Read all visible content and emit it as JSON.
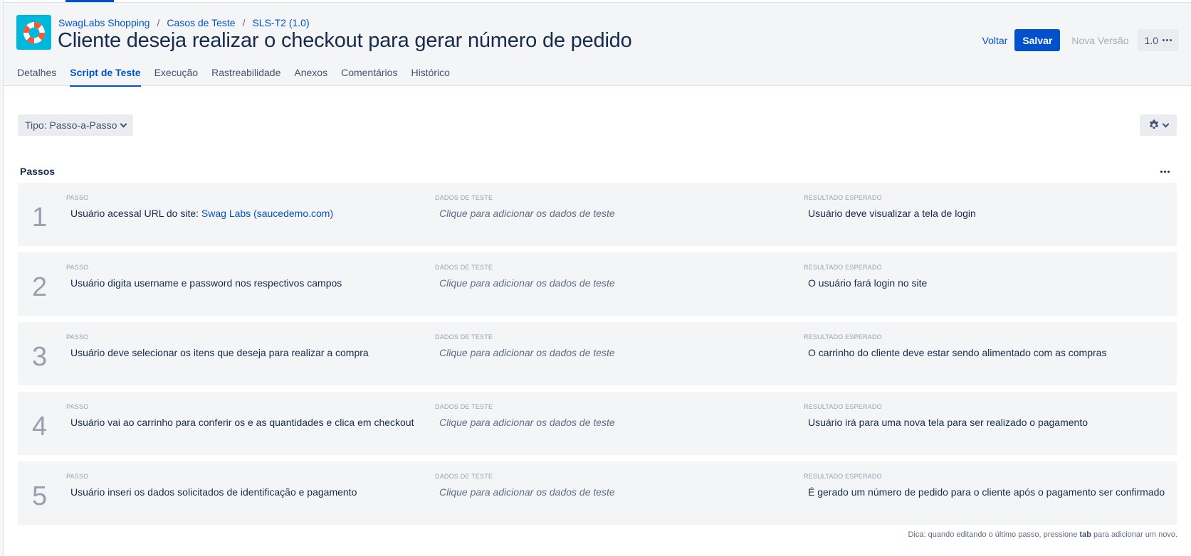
{
  "breadcrumb": {
    "project": "SwagLabs Shopping",
    "section": "Casos de Teste",
    "item": "SLS-T2 (1.0)",
    "separator": "/"
  },
  "page_title": "Cliente deseja realizar o checkout para gerar número de pedido",
  "actions": {
    "back_label": "Voltar",
    "save_label": "Salvar",
    "new_version_label": "Nova Versão",
    "version_label": "1.0"
  },
  "tabs": [
    {
      "label": "Detalhes"
    },
    {
      "label": "Script de Teste"
    },
    {
      "label": "Execução"
    },
    {
      "label": "Rastreabilidade"
    },
    {
      "label": "Anexos"
    },
    {
      "label": "Comentários"
    },
    {
      "label": "Histórico"
    }
  ],
  "active_tab": "Script de Teste",
  "type_select": {
    "label": "Tipo: Passo-a-Passo"
  },
  "section_title": "Passos",
  "column_labels": {
    "step": "PASSO",
    "data": "DADOS DE TESTE",
    "result": "RESULTADO ESPERADO"
  },
  "steps": [
    {
      "number": "1",
      "step_text": "Usuário acessal URL do site: ",
      "step_link": "Swag Labs (saucedemo.com)",
      "data_placeholder": "Clique para adicionar os dados de teste",
      "result": "Usuário deve visualizar a tela de login"
    },
    {
      "number": "2",
      "step_text": "Usuário digita username e password nos respectivos campos",
      "step_link": "",
      "data_placeholder": "Clique para adicionar os dados de teste",
      "result": "O usuário fará login no site"
    },
    {
      "number": "3",
      "step_text": "Usuário deve selecionar os itens que deseja para realizar a compra",
      "step_link": "",
      "data_placeholder": "Clique para adicionar os dados de teste",
      "result": "O carrinho do cliente deve estar sendo alimentado com as compras"
    },
    {
      "number": "4",
      "step_text": "Usuário vai ao carrinho para conferir os e as quantidades e clica em checkout",
      "step_link": "",
      "data_placeholder": "Clique para adicionar os dados de teste",
      "result": "Usuário irá para uma nova tela para ser realizado o pagamento"
    },
    {
      "number": "5",
      "step_text": "Usuário inseri os dados solicitados de identificação e pagamento",
      "step_link": "",
      "data_placeholder": "Clique para adicionar os dados de teste",
      "result": "É gerado um número de pedido para o cliente após o pagamento ser confirmado"
    }
  ],
  "tip": {
    "before": "Dica: quando editando o último passo, pressione ",
    "key": "tab",
    "after": " para adicionar um novo."
  },
  "colors": {
    "accent": "#0052cc",
    "app_icon_bg": "#00b8d9",
    "step_bg": "#f4f5f7"
  },
  "icons": {
    "app": "lifebuoy-icon",
    "settings": "gear-icon",
    "dropdown": "chevron-down-icon",
    "more": "more-horizontal-icon"
  }
}
